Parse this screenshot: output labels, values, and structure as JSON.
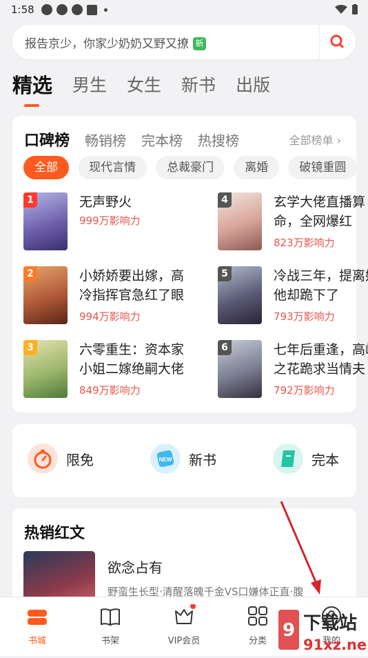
{
  "status": {
    "time": "1:58"
  },
  "search": {
    "placeholder": "报告京少，你家少奶奶又野又撩",
    "badge": "新"
  },
  "tabs": [
    "精选",
    "男生",
    "女生",
    "新书",
    "出版"
  ],
  "rank": {
    "tabs": [
      "口碑榜",
      "畅销榜",
      "完本榜",
      "热搜榜"
    ],
    "all": "全部榜单 ›",
    "chips": [
      "全部",
      "现代言情",
      "总裁豪门",
      "离婚",
      "破镜重圆"
    ],
    "books": [
      {
        "rank": "1",
        "title": "无声野火",
        "influence": "999万影响力"
      },
      {
        "rank": "2",
        "title": "小娇娇要出嫁，高冷指挥官急红了眼",
        "influence": "994万影响力"
      },
      {
        "rank": "3",
        "title": "六零重生：资本家小姐二嫁绝嗣大佬",
        "influence": "849万影响力"
      },
      {
        "rank": "4",
        "title": "玄学大佬直播算命，全网爆红",
        "influence": "823万影响力"
      },
      {
        "rank": "5",
        "title": "冷战三年，提离婚他却跪下了",
        "influence": "793万影响力"
      },
      {
        "rank": "6",
        "title": "七年后重逢，高岭之花跪求当情夫",
        "influence": "792万影响力"
      }
    ]
  },
  "quick": [
    {
      "label": "限免"
    },
    {
      "label": "新书"
    },
    {
      "label": "完本"
    }
  ],
  "hot": {
    "title": "热销红文",
    "book_title": "欲念占有",
    "book_desc": "野蛮生长型·清醒落魄千金VS口嫌体正直·腹"
  },
  "nav": [
    {
      "label": "书城"
    },
    {
      "label": "书架"
    },
    {
      "label": "VIP会员"
    },
    {
      "label": "分类"
    },
    {
      "label": "我的"
    }
  ],
  "watermark": {
    "line1": "下载站",
    "line2": "91xz.net"
  },
  "colors": {
    "accent": "#ff5a1f",
    "influence": "#e8554c"
  }
}
